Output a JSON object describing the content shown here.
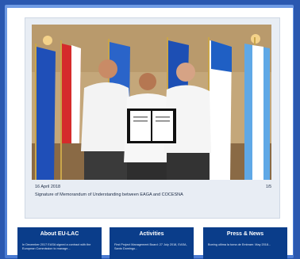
{
  "slide": {
    "date": "16 April 2018",
    "caption": "Signature of Memorandum of Understanding between EAGA and COCESNA",
    "counter": "1/5"
  },
  "panels": [
    {
      "title": "About EU-LAC",
      "body": "In December 2017 EASA signed a contract with the European Commission to manage..."
    },
    {
      "title": "Activities",
      "body": "First Project Management Board: 27 July 2018, EASA, Santo Domingo..."
    },
    {
      "title": "Press & News",
      "body": "Boeing ultima la toma de Embraer. May 2018..."
    }
  ],
  "colors": {
    "background": "#2a58b0",
    "panel": "#0a3d8a",
    "card": "#e8edf4"
  }
}
